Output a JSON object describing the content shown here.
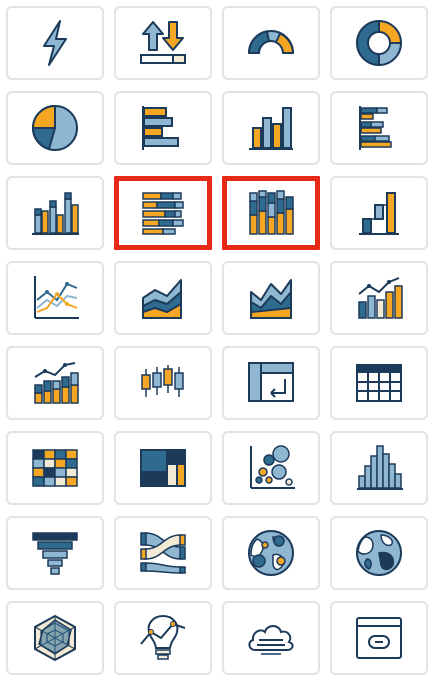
{
  "colors": {
    "navy": "#1c3a5a",
    "blue": "#2e6b8f",
    "light_blue": "#8fb7d2",
    "orange": "#f5a623",
    "cream": "#f3ead6",
    "selection_border": "#e62a17",
    "tile_border": "#e3e3e3"
  },
  "palette": {
    "selected_tiles": [
      "stacked-bar-chart",
      "stacked-column-chart"
    ],
    "tiles": [
      {
        "name": "kpi-lightning",
        "icon": "lightning-icon"
      },
      {
        "name": "import-export",
        "icon": "up-down-arrows-icon"
      },
      {
        "name": "gauge",
        "icon": "gauge-icon"
      },
      {
        "name": "donut-chart",
        "icon": "donut-icon"
      },
      {
        "name": "pie-chart",
        "icon": "pie-icon"
      },
      {
        "name": "horizontal-bar-chart",
        "icon": "horizontal-bar-icon"
      },
      {
        "name": "column-chart",
        "icon": "column-icon"
      },
      {
        "name": "horizontal-grouped-bar-chart",
        "icon": "grouped-bar-icon"
      },
      {
        "name": "grouped-column-chart",
        "icon": "grouped-column-icon"
      },
      {
        "name": "stacked-bar-chart",
        "icon": "stacked-bar-icon"
      },
      {
        "name": "stacked-column-chart",
        "icon": "stacked-column-icon"
      },
      {
        "name": "waterfall-chart",
        "icon": "waterfall-icon"
      },
      {
        "name": "line-chart",
        "icon": "line-icon"
      },
      {
        "name": "area-chart",
        "icon": "area-icon"
      },
      {
        "name": "stacked-area-chart",
        "icon": "stacked-area-icon"
      },
      {
        "name": "combo-chart",
        "icon": "combo-icon"
      },
      {
        "name": "combo-stacked-chart",
        "icon": "combo-stacked-icon"
      },
      {
        "name": "box-plot",
        "icon": "box-plot-icon"
      },
      {
        "name": "pivot-table",
        "icon": "pivot-table-icon"
      },
      {
        "name": "table",
        "icon": "table-icon"
      },
      {
        "name": "heatmap",
        "icon": "heatmap-icon"
      },
      {
        "name": "treemap",
        "icon": "treemap-icon"
      },
      {
        "name": "bubble-chart",
        "icon": "bubble-icon"
      },
      {
        "name": "histogram",
        "icon": "histogram-icon"
      },
      {
        "name": "funnel-chart",
        "icon": "funnel-icon"
      },
      {
        "name": "sankey-diagram",
        "icon": "sankey-icon"
      },
      {
        "name": "bubble-map",
        "icon": "globe-bubbles-icon"
      },
      {
        "name": "choropleth-map",
        "icon": "globe-icon"
      },
      {
        "name": "radar-chart",
        "icon": "radar-icon"
      },
      {
        "name": "insight",
        "icon": "lightbulb-icon"
      },
      {
        "name": "cloud-data",
        "icon": "cloud-icon"
      },
      {
        "name": "embed-web",
        "icon": "web-link-icon"
      }
    ]
  }
}
